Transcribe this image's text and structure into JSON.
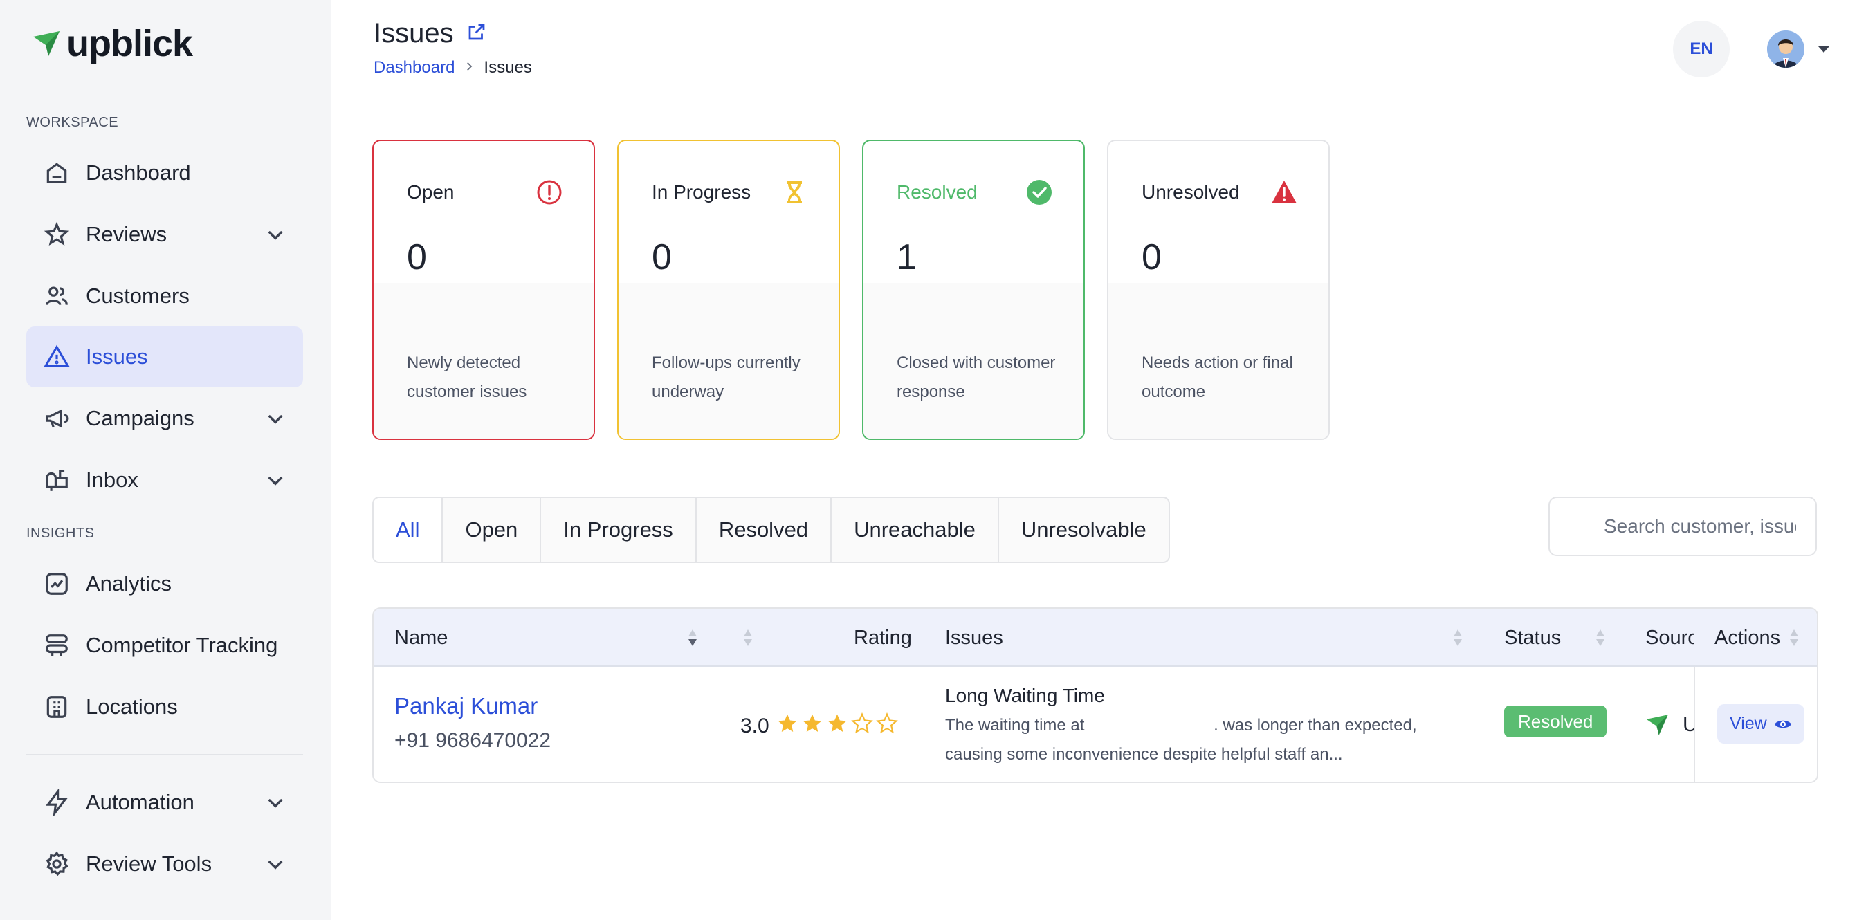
{
  "brand": {
    "name": "upblick"
  },
  "sidebar": {
    "sections": {
      "workspace": "WORKSPACE",
      "insights": "INSIGHTS"
    },
    "items": [
      {
        "label": "Dashboard",
        "icon": "home-icon",
        "expandable": false,
        "active": false
      },
      {
        "label": "Reviews",
        "icon": "star-outline-icon",
        "expandable": true,
        "active": false
      },
      {
        "label": "Customers",
        "icon": "users-icon",
        "expandable": false,
        "active": false
      },
      {
        "label": "Issues",
        "icon": "warning-icon",
        "expandable": false,
        "active": true
      },
      {
        "label": "Campaigns",
        "icon": "megaphone-icon",
        "expandable": true,
        "active": false
      },
      {
        "label": "Inbox",
        "icon": "mailbox-icon",
        "expandable": true,
        "active": false
      },
      {
        "label": "Analytics",
        "icon": "chart-icon",
        "expandable": false,
        "active": false
      },
      {
        "label": "Competitor Tracking",
        "icon": "layers-icon",
        "expandable": false,
        "active": false
      },
      {
        "label": "Locations",
        "icon": "building-icon",
        "expandable": false,
        "active": false
      },
      {
        "label": "Automation",
        "icon": "lightning-icon",
        "expandable": true,
        "active": false
      },
      {
        "label": "Review Tools",
        "icon": "gear-icon",
        "expandable": true,
        "active": false
      }
    ]
  },
  "header": {
    "title": "Issues",
    "breadcrumb": {
      "parent": "Dashboard",
      "current": "Issues"
    },
    "language": "EN"
  },
  "stats": [
    {
      "title": "Open",
      "value": "0",
      "description": "Newly detected customer issues",
      "icon": "alert-circle-icon",
      "color": "#d9323f"
    },
    {
      "title": "In Progress",
      "value": "0",
      "description": "Follow-ups currently underway",
      "icon": "hourglass-icon",
      "color": "#f1c232"
    },
    {
      "title": "Resolved",
      "value": "1",
      "description": "Closed with customer response",
      "icon": "check-circle-icon",
      "color": "#4fb96a"
    },
    {
      "title": "Unresolved",
      "value": "0",
      "description": "Needs action or final outcome",
      "icon": "warning-triangle-icon",
      "color": "#d9323f"
    }
  ],
  "filters": {
    "tabs": [
      "All",
      "Open",
      "In Progress",
      "Resolved",
      "Unreachable",
      "Unresolvable"
    ],
    "active": "All"
  },
  "search": {
    "placeholder": "Search customer, issue"
  },
  "table": {
    "columns": {
      "name": "Name",
      "rating": "Rating",
      "issues": "Issues",
      "status": "Status",
      "source": "Source",
      "actions": "Actions"
    },
    "rows": [
      {
        "name": "Pankaj Kumar",
        "phone": "+91 9686470022",
        "rating": "3.0",
        "stars": 3,
        "issue_title": "Long Waiting Time",
        "issue_text": "The waiting time at                            . was longer than expected, causing some inconvenience despite helpful staff an...",
        "status": "Resolved",
        "source": "U",
        "action": "View"
      }
    ]
  },
  "colors": {
    "accent": "#2c4fd8",
    "active_bg": "#e3e6fa",
    "success": "#5bbd72"
  }
}
